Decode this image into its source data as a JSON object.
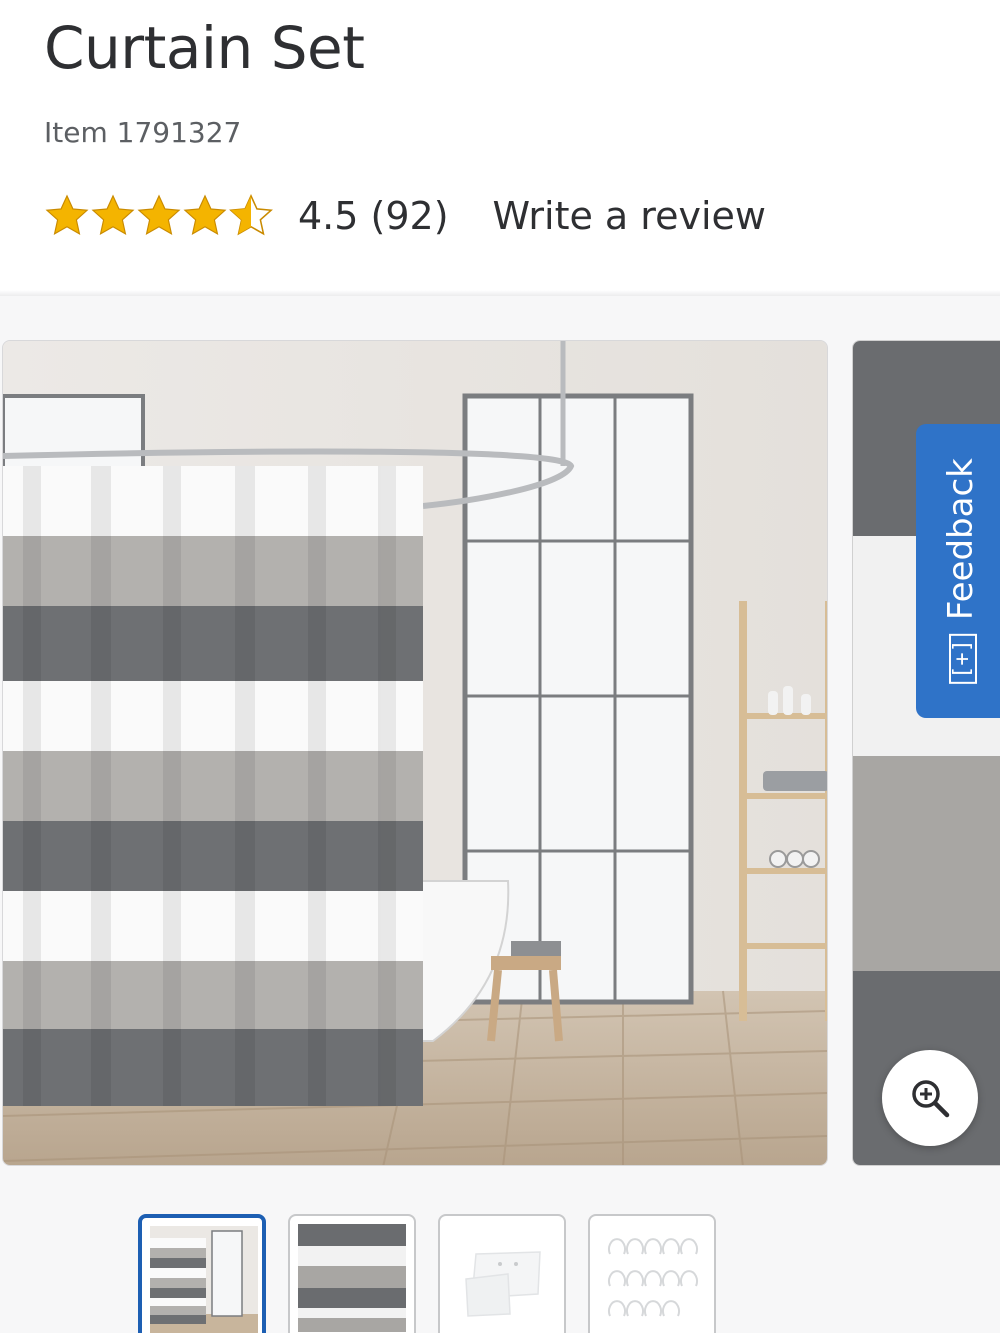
{
  "product": {
    "title": "Curtain Set",
    "item_label": "Item 1791327"
  },
  "rating": {
    "value": 4.5,
    "text": "4.5 (92)",
    "max_stars": 5,
    "star_color": "#f4b400",
    "write_review_label": "Write a review"
  },
  "gallery": {
    "main_image": "striped-shower-curtain-bathroom-photo",
    "side_image": "striped-fabric-closeup-photo",
    "feedback_label": "Feedback",
    "feedback_icon": "[+]",
    "feedback_color": "#2f73c8",
    "zoom_icon": "zoom-in-icon",
    "thumbnails": [
      {
        "name": "bathroom-scene",
        "selected": true
      },
      {
        "name": "curtain-closeup",
        "selected": false
      },
      {
        "name": "liner",
        "selected": false
      },
      {
        "name": "hooks",
        "selected": false
      }
    ],
    "accent_color": "#1d5fb3"
  }
}
